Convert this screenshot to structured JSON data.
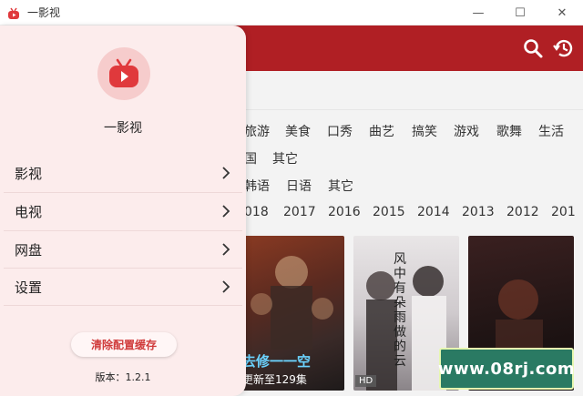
{
  "window": {
    "title": "一影视",
    "controls": {
      "minimize": "—",
      "maximize": "☐",
      "close": "✕"
    }
  },
  "header": {
    "search_icon": "search-icon",
    "history_icon": "history-icon",
    "accent": "#b01f24"
  },
  "filters": {
    "row1": [
      "旅游",
      "美食",
      "口秀",
      "曲艺",
      "搞笑",
      "游戏",
      "歌舞",
      "生活"
    ],
    "row2": [
      "国",
      "其它"
    ],
    "row3": [
      "韩语",
      "日语",
      "其它"
    ],
    "years": [
      "018",
      "2017",
      "2016",
      "2015",
      "2014",
      "2013",
      "2012",
      "201"
    ]
  },
  "posters": [
    {
      "caption": "更新至129集",
      "overlay": "去修一一空"
    },
    {
      "badge": "HD",
      "overlay": "风中有朵雨做的云"
    },
    {
      "overlay": ""
    }
  ],
  "watermark": {
    "text": "www.08rj.com"
  },
  "drawer": {
    "app_name": "一影视",
    "logo_icon": "tv-play-icon",
    "menu": [
      {
        "label": "影视"
      },
      {
        "label": "电视"
      },
      {
        "label": "网盘"
      },
      {
        "label": "设置"
      }
    ],
    "clear_cache_label": "清除配置缓存",
    "version": "版本：1.2.1"
  }
}
